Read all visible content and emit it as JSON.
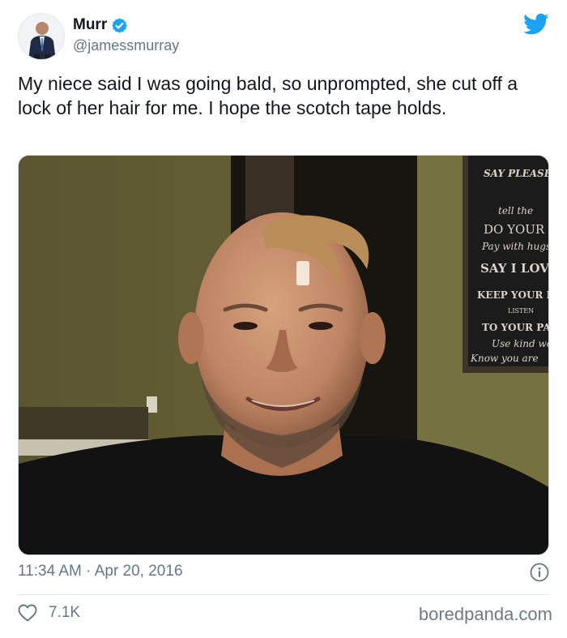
{
  "author": {
    "display_name": "Murr",
    "handle": "@jamessmurray",
    "verified": true
  },
  "tweet": {
    "text": "My niece said I was going bald, so unprompted, she cut off a lock of her hair for me. I hope the scotch tape holds.",
    "timestamp": "11:34 AM · Apr 20, 2016",
    "likes": "7.1K"
  },
  "sign_lines": [
    "SAY PLEASE &",
    "tell the",
    "DO YOUR",
    "Pay with hugs",
    "SAY I LOVE",
    "KEEP YOUR PR",
    "LISTEN",
    "TO YOUR PAR",
    "Use kind wo",
    "Know you are"
  ],
  "watermark": "boredpanda.com",
  "colors": {
    "twitter_blue": "#1da1f2",
    "text_primary": "#14171a",
    "text_secondary": "#657786",
    "divider": "#e1e8ed"
  },
  "icons": {
    "verified": "verified-badge-icon",
    "brand": "twitter-bird-icon",
    "info": "info-icon",
    "like": "heart-icon"
  }
}
